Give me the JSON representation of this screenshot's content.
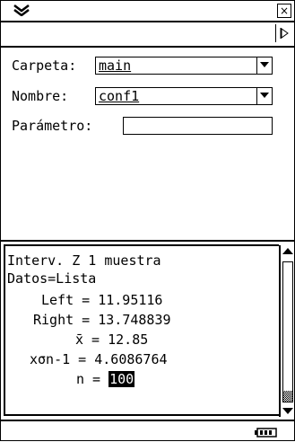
{
  "window": {
    "menu_icon": "chevron-down-double-icon",
    "close_symbol": "×"
  },
  "toolbar": {
    "arrow_icon": "triangle-right-icon"
  },
  "form": {
    "folder_label": "Carpeta:",
    "folder_value": "main",
    "name_label": "Nombre:",
    "name_value": "conf1",
    "param_label": "Parámetro:",
    "param_value": ""
  },
  "output": {
    "title": "Interv. Z 1 muestra",
    "data_line": "Datos=Lista",
    "results": [
      {
        "label": "Left",
        "value": "11.95116"
      },
      {
        "label": "Right",
        "value": "13.748839"
      },
      {
        "label": "x̄",
        "value": "12.85"
      },
      {
        "label": "xσn-1",
        "value": "4.6086764"
      },
      {
        "label": "n",
        "value": "100"
      }
    ]
  },
  "status": {
    "battery_icon": "battery-icon"
  }
}
